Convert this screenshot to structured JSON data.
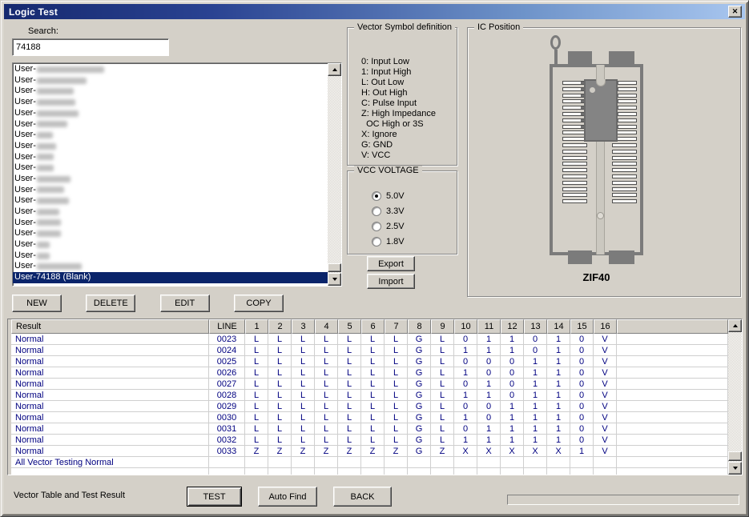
{
  "window": {
    "title": "Logic Test",
    "close_glyph": "✕"
  },
  "colors": {
    "face": "#d4d0c8",
    "titlebar_left": "#16296f",
    "titlebar_right": "#a8c6ef",
    "selection": "#0a246a",
    "table_text": "#000080"
  },
  "search": {
    "label": "Search:",
    "value": "74188"
  },
  "device_list": {
    "item_prefix": "User-",
    "redacted_item_count": 19,
    "selected_item": "User-74188 (Blank)"
  },
  "list_actions": [
    "NEW",
    "DELETE",
    "EDIT",
    "COPY"
  ],
  "vector_symbol_panel": {
    "title": "Vector Symbol definition",
    "lines": [
      "0: Input Low",
      "1: Input High",
      "L: Out Low",
      "H: Out High",
      "C: Pulse Input",
      "Z: High Impedance",
      "  OC High or 3S",
      "X: Ignore",
      "G: GND",
      "V: VCC"
    ]
  },
  "vcc_panel": {
    "title": "VCC VOLTAGE",
    "options": [
      {
        "label": "5.0V",
        "selected": true
      },
      {
        "label": "3.3V",
        "selected": false
      },
      {
        "label": "2.5V",
        "selected": false
      },
      {
        "label": "1.8V",
        "selected": false
      }
    ]
  },
  "transfer_buttons": {
    "export": "Export",
    "import": "Import"
  },
  "ic_position_panel": {
    "title": "IC Position",
    "socket_label": "ZIF40"
  },
  "table": {
    "headers": [
      "Result",
      "LINE",
      "1",
      "2",
      "3",
      "4",
      "5",
      "6",
      "7",
      "8",
      "9",
      "10",
      "11",
      "12",
      "13",
      "14",
      "15",
      "16"
    ],
    "rows": [
      {
        "result": "Normal",
        "line": "0023",
        "values": [
          "L",
          "L",
          "L",
          "L",
          "L",
          "L",
          "L",
          "G",
          "L",
          "0",
          "1",
          "1",
          "0",
          "1",
          "0",
          "V"
        ]
      },
      {
        "result": "Normal",
        "line": "0024",
        "values": [
          "L",
          "L",
          "L",
          "L",
          "L",
          "L",
          "L",
          "G",
          "L",
          "1",
          "1",
          "1",
          "0",
          "1",
          "0",
          "V"
        ]
      },
      {
        "result": "Normal",
        "line": "0025",
        "values": [
          "L",
          "L",
          "L",
          "L",
          "L",
          "L",
          "L",
          "G",
          "L",
          "0",
          "0",
          "0",
          "1",
          "1",
          "0",
          "V"
        ]
      },
      {
        "result": "Normal",
        "line": "0026",
        "values": [
          "L",
          "L",
          "L",
          "L",
          "L",
          "L",
          "L",
          "G",
          "L",
          "1",
          "0",
          "0",
          "1",
          "1",
          "0",
          "V"
        ]
      },
      {
        "result": "Normal",
        "line": "0027",
        "values": [
          "L",
          "L",
          "L",
          "L",
          "L",
          "L",
          "L",
          "G",
          "L",
          "0",
          "1",
          "0",
          "1",
          "1",
          "0",
          "V"
        ]
      },
      {
        "result": "Normal",
        "line": "0028",
        "values": [
          "L",
          "L",
          "L",
          "L",
          "L",
          "L",
          "L",
          "G",
          "L",
          "1",
          "1",
          "0",
          "1",
          "1",
          "0",
          "V"
        ]
      },
      {
        "result": "Normal",
        "line": "0029",
        "values": [
          "L",
          "L",
          "L",
          "L",
          "L",
          "L",
          "L",
          "G",
          "L",
          "0",
          "0",
          "1",
          "1",
          "1",
          "0",
          "V"
        ]
      },
      {
        "result": "Normal",
        "line": "0030",
        "values": [
          "L",
          "L",
          "L",
          "L",
          "L",
          "L",
          "L",
          "G",
          "L",
          "1",
          "0",
          "1",
          "1",
          "1",
          "0",
          "V"
        ]
      },
      {
        "result": "Normal",
        "line": "0031",
        "values": [
          "L",
          "L",
          "L",
          "L",
          "L",
          "L",
          "L",
          "G",
          "L",
          "0",
          "1",
          "1",
          "1",
          "1",
          "0",
          "V"
        ]
      },
      {
        "result": "Normal",
        "line": "0032",
        "values": [
          "L",
          "L",
          "L",
          "L",
          "L",
          "L",
          "L",
          "G",
          "L",
          "1",
          "1",
          "1",
          "1",
          "1",
          "0",
          "V"
        ]
      },
      {
        "result": "Normal",
        "line": "0033",
        "values": [
          "Z",
          "Z",
          "Z",
          "Z",
          "Z",
          "Z",
          "Z",
          "G",
          "Z",
          "X",
          "X",
          "X",
          "X",
          "X",
          "1",
          "V"
        ]
      }
    ],
    "footer_row": "All Vector Testing Normal"
  },
  "footer": {
    "caption": "Vector Table and Test Result",
    "buttons": [
      "TEST",
      "Auto Find",
      "BACK"
    ]
  }
}
